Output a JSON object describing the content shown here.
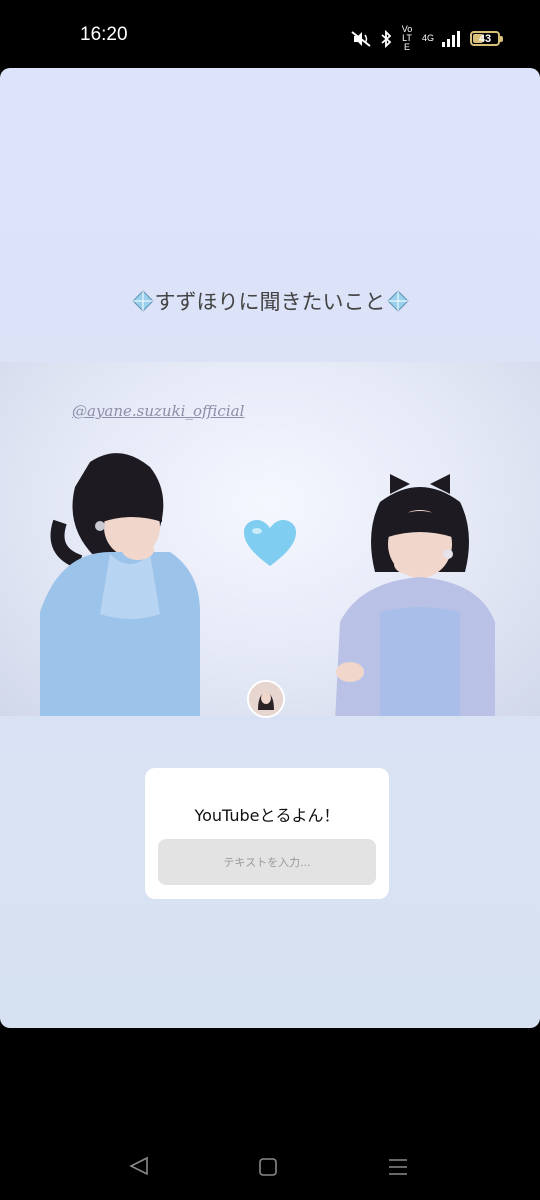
{
  "status_bar": {
    "time": "16:20",
    "network": "Vo LTE",
    "network_type": "4G",
    "battery": "43",
    "battery_level_percent": 43,
    "icons": [
      "mute-vibrate-icon",
      "bluetooth-icon",
      "signal-icon",
      "battery-icon"
    ]
  },
  "story": {
    "title": "すずほりに聞きたいこと",
    "title_emoji": "diamond-icon",
    "photo": {
      "handle": "@ayane.suzuki_official",
      "emoji": "blue-heart-icon"
    },
    "question_sticker": {
      "prompt": "YouTubeとるよん！",
      "placeholder": "テキストを入力..."
    }
  },
  "colors": {
    "background": "#dde3fb",
    "accent_heart": "#7fcdf0",
    "battery": "#d8c07a"
  },
  "nav_bar": {
    "icons": [
      "back-icon",
      "home-icon",
      "recents-icon"
    ]
  }
}
